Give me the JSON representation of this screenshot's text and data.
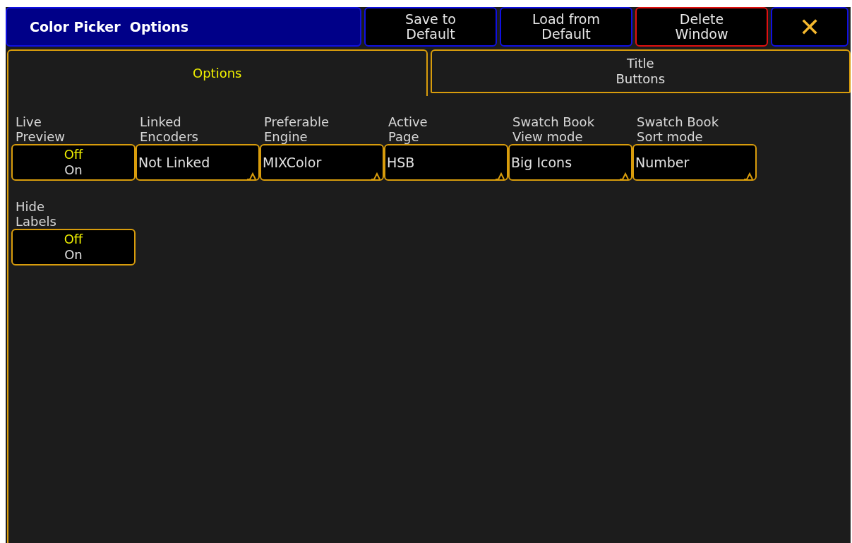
{
  "window": {
    "title": "Color Picker  Options"
  },
  "header_buttons": [
    {
      "label": "Save to\nDefault",
      "kind": "normal"
    },
    {
      "label": "Load from\nDefault",
      "kind": "normal"
    },
    {
      "label": "Delete\nWindow",
      "kind": "danger"
    },
    {
      "label": "✕",
      "kind": "close"
    }
  ],
  "tabs": [
    {
      "label": "Options",
      "selected": true
    },
    {
      "label": "Title\nButtons",
      "selected": false
    }
  ],
  "settings": [
    [
      {
        "label": "Live\nPreview",
        "kind": "toggle",
        "options": [
          {
            "label": "Off",
            "selected": true
          },
          {
            "label": "On",
            "selected": false
          }
        ]
      },
      {
        "label": "Linked\nEncoders",
        "kind": "dropdown",
        "value": "Not Linked"
      },
      {
        "label": "Preferable\nEngine",
        "kind": "dropdown",
        "value": "MIXColor"
      },
      {
        "label": "Active\nPage",
        "kind": "dropdown",
        "value": "HSB"
      },
      {
        "label": "Swatch Book\nView mode",
        "kind": "dropdown",
        "value": "Big Icons"
      },
      {
        "label": "Swatch Book\nSort mode",
        "kind": "dropdown",
        "value": "Number"
      }
    ],
    [
      {
        "label": "Hide\nLabels",
        "kind": "toggle",
        "options": [
          {
            "label": "Off",
            "selected": true
          },
          {
            "label": "On",
            "selected": false
          }
        ]
      }
    ]
  ]
}
